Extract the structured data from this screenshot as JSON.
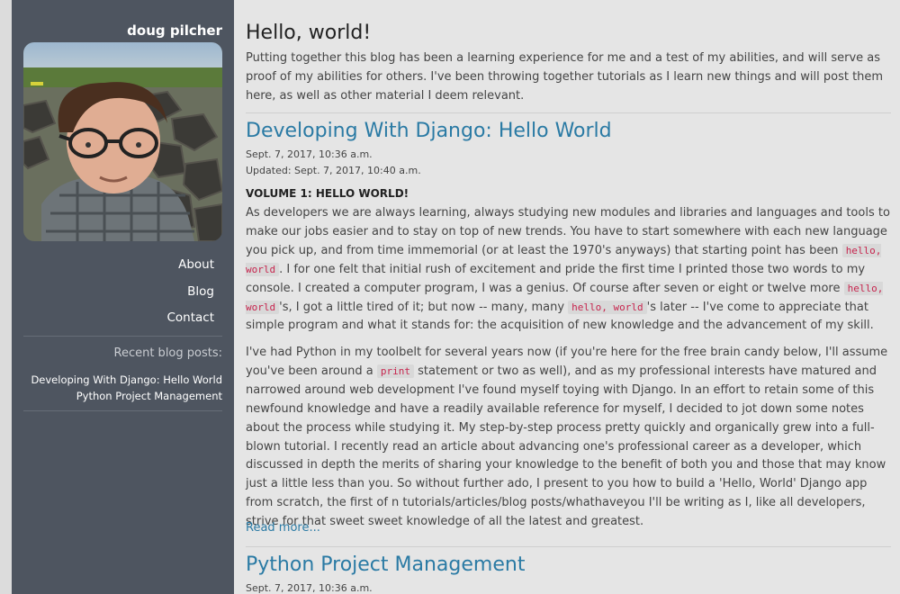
{
  "sidebar": {
    "site_name": "doug pilcher",
    "nav": [
      {
        "label": "About"
      },
      {
        "label": "Blog"
      },
      {
        "label": "Contact"
      }
    ],
    "recent_title": "Recent blog posts:",
    "recent_posts": [
      {
        "label": "Developing With Django: Hello World"
      },
      {
        "label": "Python Project Management"
      }
    ]
  },
  "intro": {
    "title": "Hello, world!",
    "text": "Putting together this blog has been a learning experience for me and a test of my abilities, and will serve as proof of my abilities for others. I've been throwing together tutorials as I learn new things and will post them here, as well as other material I deem relevant."
  },
  "posts": [
    {
      "title": "Developing With Django: Hello World",
      "date": "Sept. 7, 2017, 10:36 a.m.",
      "updated": "Updated: Sept. 7, 2017, 10:40 a.m.",
      "volume": "VOLUME 1: HELLO WORLD!",
      "p1": {
        "a": "As developers we are always learning, always studying new modules and libraries and languages and tools to make our jobs easier and to stay on top of new trends. You have to start somewhere with each new language you pick up, and from time immemorial (or at least the 1970's anyways) that starting point has been ",
        "code1": "hello, world",
        "b": ". I for one felt that initial rush of excitement and pride the first time I printed those two words to my console. I created a computer program, I was a genius. Of course after seven or eight or twelve more ",
        "code2": "hello, world",
        "c": "'s, I got a little tired of it; but now -- many, many ",
        "code3": "hello, world",
        "d": "'s later -- I've come to appreciate that simple program and what it stands for: the acquisition of new knowledge and the advancement of my skill."
      },
      "p2": {
        "a": "I've had Python in my toolbelt for several years now (if you're here for the free brain candy below, I'll assume you've been around a ",
        "code1": "print",
        "b": " statement or two as well), and as my professional interests have matured and narrowed around web development I've found myself toying with Django. In an effort to retain some of this newfound knowledge and have a readily available reference for myself, I decided to jot down some notes about the process while studying it. My step-by-step process pretty quickly and organically grew into a full-blown tutorial. I recently read an article about advancing one's professional career as a developer, which discussed in depth the merits of sharing your knowledge to the benefit of both you and those that may know just a little less than you. So without further ado, I present to you how to build a 'Hello, World' Django app from scratch, the first of n tutorials/articles/blog posts/whathaveyou I'll be writing as I, like all developers, strive for that sweet sweet knowledge of all the latest and greatest."
      },
      "read_more": "Read more..."
    },
    {
      "title": "Python Project Management",
      "date": "Sept. 7, 2017, 10:36 a.m."
    }
  ],
  "colors": {
    "sidebar_bg": "#4e5560",
    "link": "#2a7aa4",
    "code": "#c7254e"
  }
}
